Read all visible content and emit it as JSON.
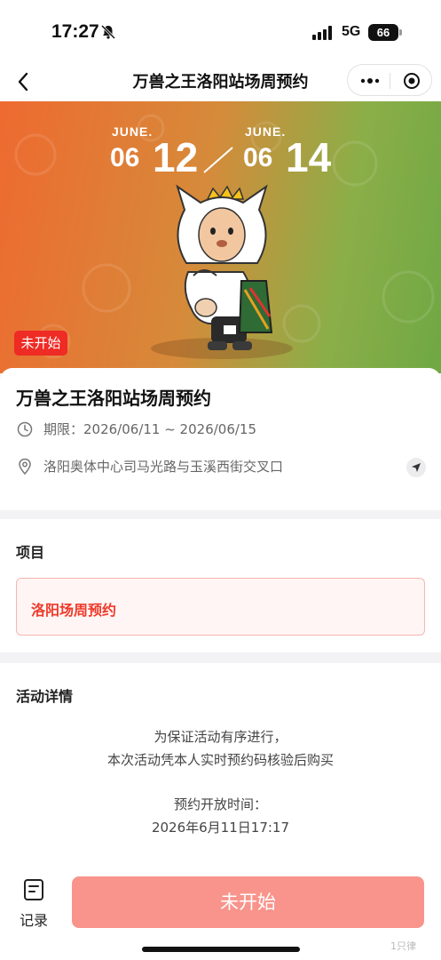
{
  "status_bar": {
    "time": "17:27",
    "network": "5G",
    "battery": "66"
  },
  "nav": {
    "title": "万兽之王洛阳站场周预约"
  },
  "hero": {
    "start": {
      "month": "JUNE.",
      "day_small": "06",
      "day_big": "12"
    },
    "end": {
      "month": "JUNE.",
      "day_small": "06",
      "day_big": "14"
    },
    "status_tag": "未开始"
  },
  "event": {
    "title": "万兽之王洛阳站场周预约",
    "period": "期限：2026/06/11 ~ 2026/06/15",
    "address": "洛阳奥体中心司马光路与玉溪西街交叉口"
  },
  "project": {
    "heading": "项目",
    "option": "洛阳场周预约"
  },
  "details": {
    "heading": "活动详情",
    "lines": [
      "为保证活动有序进行，",
      "本次活动凭本人实时预约码核验后购买",
      "预约开放时间：",
      "2026年6月11日17:17"
    ]
  },
  "bottom": {
    "record_label": "记录",
    "action_label": "未开始"
  },
  "watermark": "1只律",
  "colors": {
    "accent_red": "#ee2b24",
    "button_disabled": "#f8948c",
    "hero_left": "#ee6a30",
    "hero_right": "#6fa844"
  }
}
